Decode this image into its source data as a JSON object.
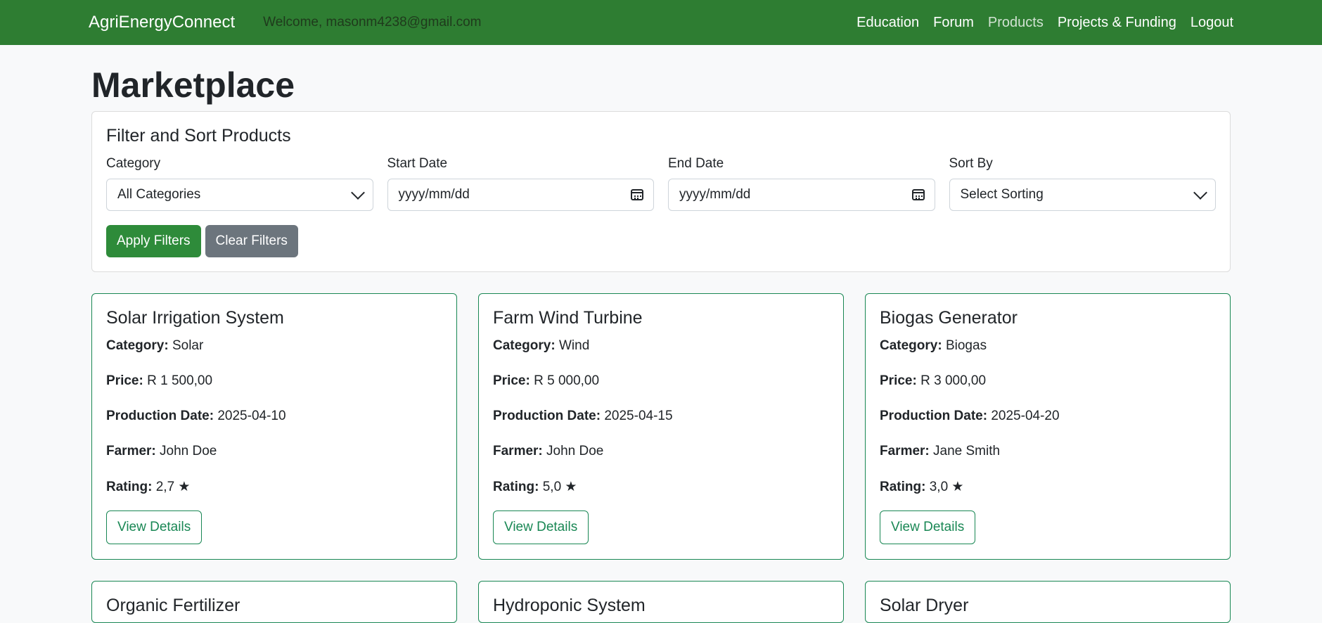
{
  "nav": {
    "brand": "AgriEnergyConnect",
    "welcome": "Welcome, masonm4238@gmail.com",
    "links": [
      "Education",
      "Forum",
      "Products",
      "Projects & Funding",
      "Logout"
    ]
  },
  "page": {
    "title": "Marketplace"
  },
  "filters": {
    "title": "Filter and Sort Products",
    "category_label": "Category",
    "category_value": "All Categories",
    "start_label": "Start Date",
    "start_placeholder": "yyyy/mm/dd",
    "end_label": "End Date",
    "end_placeholder": "yyyy/mm/dd",
    "sort_label": "Sort By",
    "sort_value": "Select Sorting",
    "apply_label": "Apply Filters",
    "clear_label": "Clear Filters"
  },
  "labels": {
    "category": "Category:",
    "price": "Price:",
    "date": "Production Date:",
    "farmer": "Farmer:",
    "rating": "Rating:",
    "view": "View Details"
  },
  "products": [
    {
      "name": "Solar Irrigation System",
      "category": "Solar",
      "price": "R 1 500,00",
      "date": "2025-04-10",
      "farmer": "John Doe",
      "rating": "2,7 ★"
    },
    {
      "name": "Farm Wind Turbine",
      "category": "Wind",
      "price": "R 5 000,00",
      "date": "2025-04-15",
      "farmer": "John Doe",
      "rating": "5,0 ★"
    },
    {
      "name": "Biogas Generator",
      "category": "Biogas",
      "price": "R 3 000,00",
      "date": "2025-04-20",
      "farmer": "Jane Smith",
      "rating": "3,0 ★"
    },
    {
      "name": "Organic Fertilizer"
    },
    {
      "name": "Hydroponic System"
    },
    {
      "name": "Solar Dryer"
    }
  ]
}
